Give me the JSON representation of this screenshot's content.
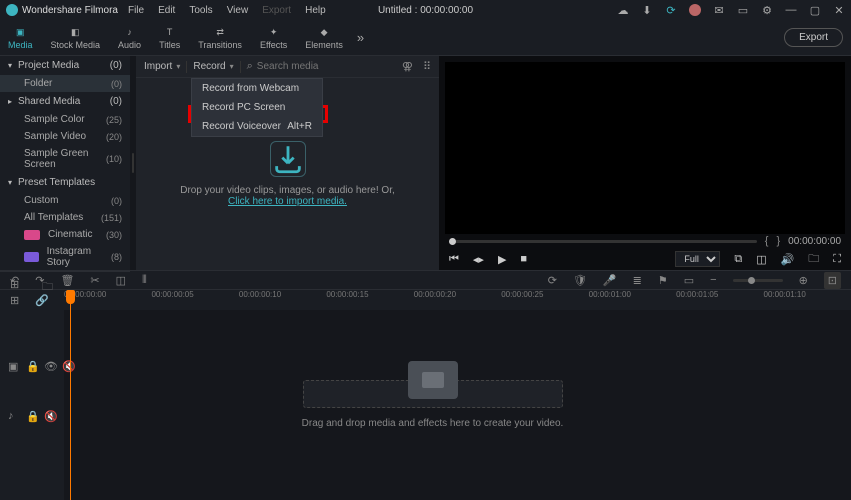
{
  "app": {
    "name": "Wondershare Filmora",
    "title": "Untitled : 00:00:00:00"
  },
  "menu": {
    "file": "File",
    "edit": "Edit",
    "tools": "Tools",
    "view": "View",
    "export": "Export",
    "help": "Help"
  },
  "toolTabs": {
    "media": "Media",
    "stock": "Stock Media",
    "audio": "Audio",
    "titles": "Titles",
    "transitions": "Transitions",
    "effects": "Effects",
    "elements": "Elements"
  },
  "export_btn": "Export",
  "sidebar": {
    "project": {
      "label": "Project Media",
      "count": "(0)"
    },
    "folder": {
      "label": "Folder",
      "count": "(0)"
    },
    "shared": {
      "label": "Shared Media",
      "count": "(0)"
    },
    "sampleColor": {
      "label": "Sample Color",
      "count": "(25)"
    },
    "sampleVideo": {
      "label": "Sample Video",
      "count": "(20)"
    },
    "sampleGreen": {
      "label": "Sample Green Screen",
      "count": "(10)"
    },
    "preset": {
      "label": "Preset Templates"
    },
    "custom": {
      "label": "Custom",
      "count": "(0)"
    },
    "allTemplates": {
      "label": "All Templates",
      "count": "(151)"
    },
    "cinematic": {
      "label": "Cinematic",
      "count": "(30)"
    },
    "instagram": {
      "label": "Instagram Story",
      "count": "(8)"
    }
  },
  "mediaBar": {
    "import": "Import",
    "record": "Record",
    "searchPlaceholder": "Search media"
  },
  "recordMenu": {
    "webcam": "Record from Webcam",
    "screen": "Record PC Screen",
    "voiceover": "Record Voiceover",
    "voiceoverShortcut": "Alt+R"
  },
  "drop": {
    "line1": "Drop your video clips, images, or audio here! Or,",
    "link": "Click here to import media."
  },
  "preview": {
    "time": "00:00:00:00",
    "quality": "Full"
  },
  "timeline": {
    "ticks": [
      "00:00:00:00",
      "00:00:00:05",
      "00:00:00:10",
      "00:00:00:15",
      "00:00:00:20",
      "00:00:00:25",
      "00:00:01:00",
      "00:00:01:05",
      "00:00:01:10"
    ],
    "hint": "Drag and drop media and effects here to create your video."
  }
}
